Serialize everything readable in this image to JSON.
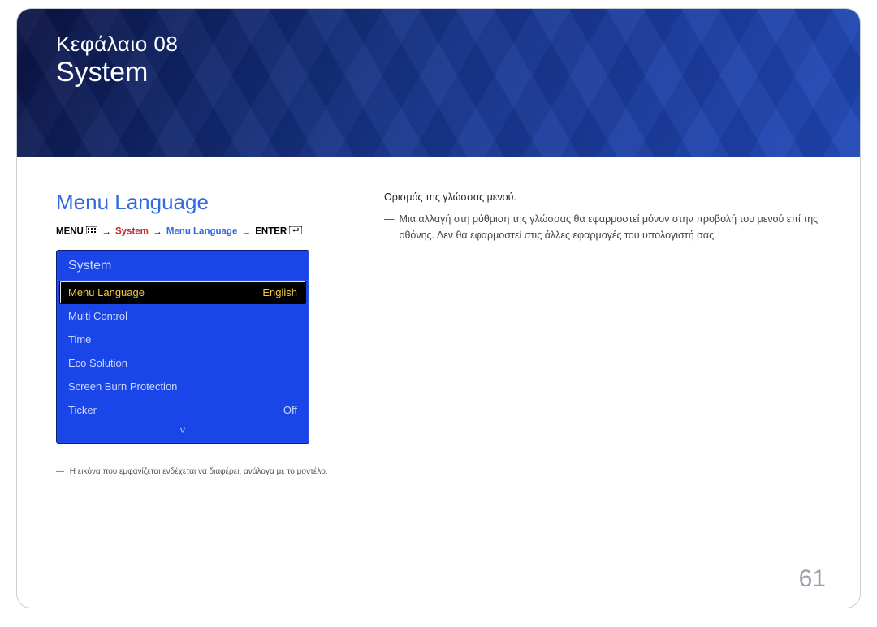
{
  "header": {
    "chapter_label": "Κεφάλαιο 08",
    "chapter_title": "System"
  },
  "left": {
    "section_title": "Menu Language",
    "nav": {
      "menu": "MENU",
      "system": "System",
      "menu_language": "Menu Language",
      "enter": "ENTER",
      "arrow": "→"
    },
    "osd": {
      "title": "System",
      "rows": [
        {
          "label": "Menu Language",
          "value": "English",
          "selected": true
        },
        {
          "label": "Multi Control",
          "value": "",
          "selected": false
        },
        {
          "label": "Time",
          "value": "",
          "selected": false
        },
        {
          "label": "Eco Solution",
          "value": "",
          "selected": false
        },
        {
          "label": "Screen Burn Protection",
          "value": "",
          "selected": false
        },
        {
          "label": "Ticker",
          "value": "Off",
          "selected": false
        }
      ],
      "more_indicator": "˅"
    },
    "footnote": "Η εικόνα που εμφανίζεται ενδέχεται να διαφέρει, ανάλογα με το μοντέλο.",
    "footnote_dash": "―"
  },
  "right": {
    "intro": "Ορισμός της γλώσσας μενού.",
    "note_dash": "―",
    "note_text": "Μια αλλαγή στη ρύθμιση της γλώσσας θα εφαρμοστεί μόνον στην προβολή του μενού επί της οθόνης. Δεν θα εφαρμοστεί στις άλλες εφαρμογές του υπολογιστή σας."
  },
  "page_number": "61"
}
